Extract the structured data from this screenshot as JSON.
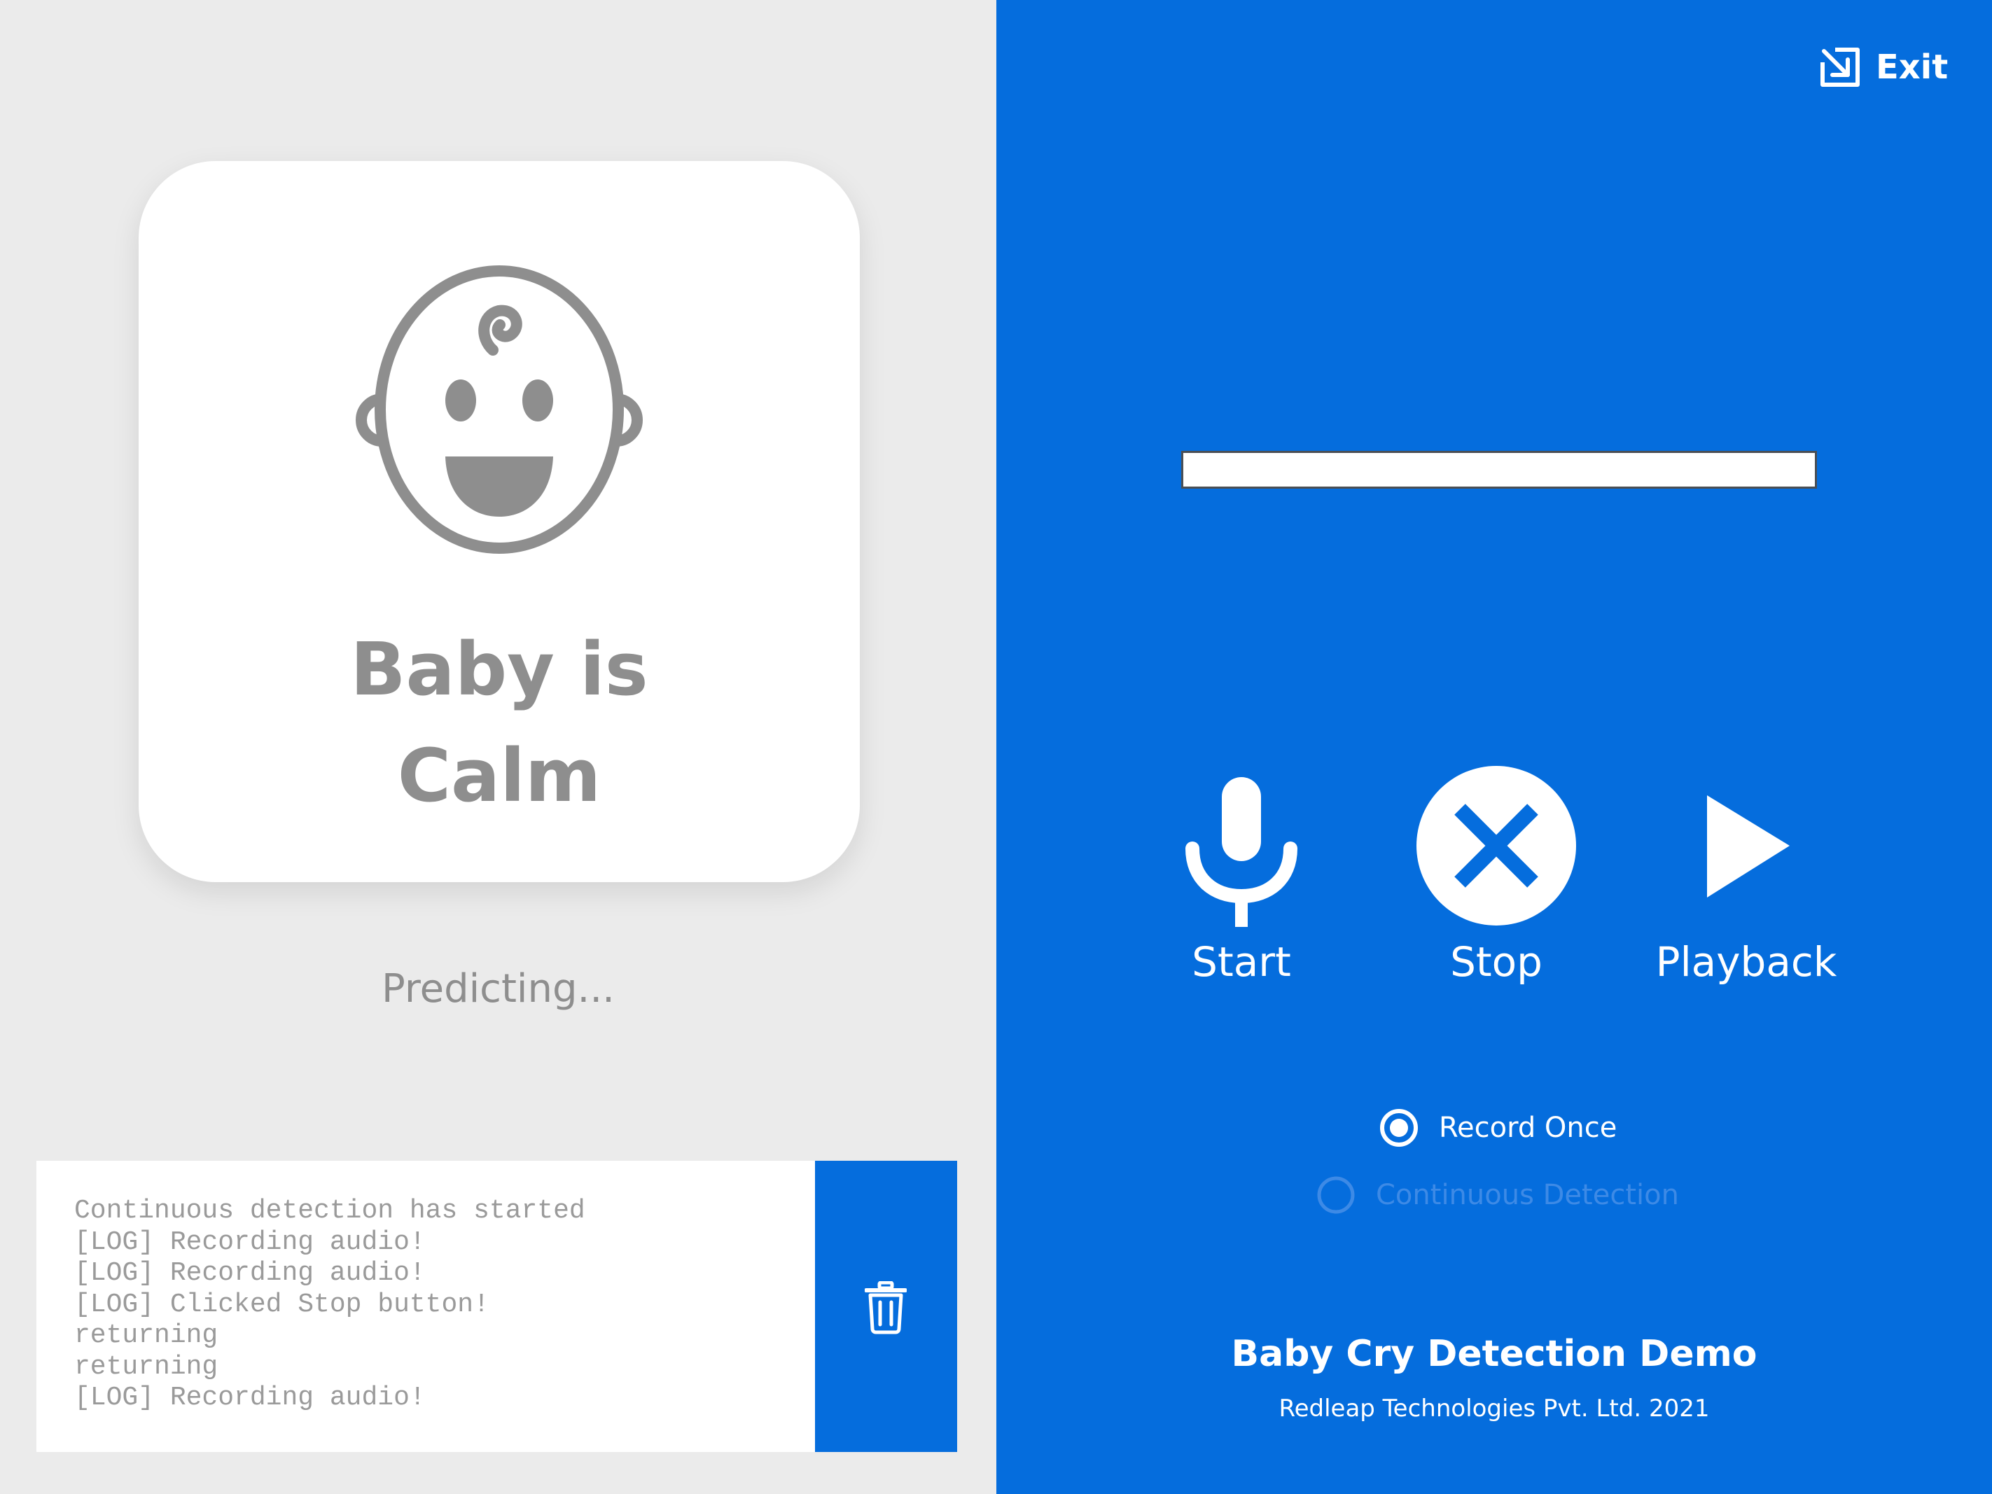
{
  "status_card": {
    "icon": "baby-face-icon",
    "status_text": "Baby is\nCalm"
  },
  "predicting_text": "Predicting...",
  "log": {
    "lines": [
      "Continuous detection has started",
      "[LOG] Recording audio!",
      "[LOG] Recording audio!",
      "[LOG] Clicked Stop button!",
      "returning",
      "returning",
      "[LOG] Recording audio!"
    ],
    "clear_icon": "trash-icon"
  },
  "header": {
    "exit_label": "Exit",
    "exit_icon": "exit-icon"
  },
  "progress": {
    "value": 0
  },
  "controls": {
    "start_label": "Start",
    "start_icon": "microphone-icon",
    "stop_label": "Stop",
    "stop_icon": "close-circle-icon",
    "playback_label": "Playback",
    "playback_icon": "play-icon"
  },
  "mode": {
    "options": [
      {
        "label": "Record Once",
        "selected": true
      },
      {
        "label": "Continuous Detection",
        "selected": false
      }
    ]
  },
  "footer": {
    "title": "Baby Cry Detection Demo",
    "subtitle": "Redleap Technologies Pvt. Ltd. 2021"
  },
  "colors": {
    "primary_blue": "#056ddd",
    "panel_gray": "#ebebeb",
    "icon_gray": "#8e8e8e",
    "white": "#ffffff"
  }
}
